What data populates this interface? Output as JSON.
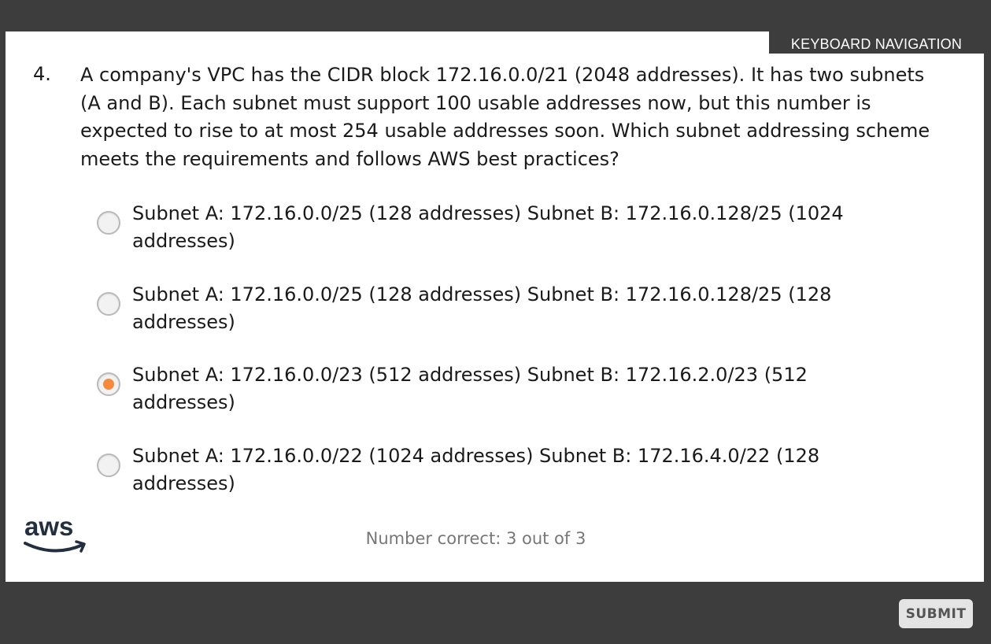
{
  "header": {
    "keyboard_navigation": "KEYBOARD NAVIGATION"
  },
  "question": {
    "number": "4.",
    "text": "A company's VPC has the CIDR block 172.16.0.0/21 (2048 addresses). It has two subnets (A and B). Each subnet must support 100 usable addresses now, but this number is expected to rise to at most 254 usable addresses soon. Which subnet addressing scheme meets the requirements and follows AWS best practices?"
  },
  "options": [
    {
      "line1": "Subnet A: 172.16.0.0/25 (128 addresses) Subnet B: 172.16.0.128/25 (1024",
      "line2": "addresses)",
      "selected": false
    },
    {
      "line1": "Subnet A: 172.16.0.0/25 (128 addresses) Subnet B: 172.16.0.128/25 (128",
      "line2": "addresses)",
      "selected": false
    },
    {
      "line1": "Subnet A: 172.16.0.0/23 (512 addresses) Subnet B: 172.16.2.0/23 (512",
      "line2": "addresses)",
      "selected": true
    },
    {
      "line1": "Subnet A: 172.16.0.0/22 (1024 addresses) Subnet B: 172.16.4.0/22 (128",
      "line2": "addresses)",
      "selected": false
    }
  ],
  "logo": {
    "text": "aws",
    "icon": "aws-smile-logo"
  },
  "score": {
    "text": "Number correct: 3 out of 3"
  },
  "footer": {
    "submit_label": "SUBMIT"
  },
  "colors": {
    "frame_background": "#3d3d3d",
    "slide_background": "#ffffff",
    "radio_selected": "#f6893b",
    "score_text": "#777777"
  }
}
